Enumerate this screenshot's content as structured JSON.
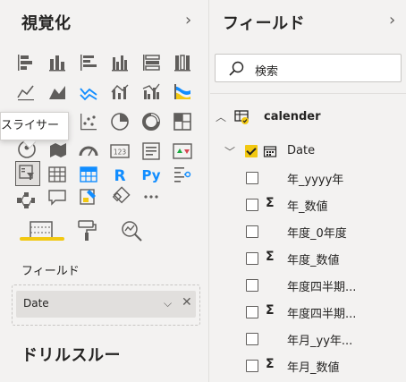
{
  "viz_pane": {
    "title": "視覚化",
    "tooltip": "スライサー",
    "section_label": "フィールド",
    "well_chip": "Date",
    "drill_title": "ドリルスルー"
  },
  "fields_pane": {
    "title": "フィールド",
    "search_placeholder": "検索",
    "table": "calender",
    "date_node": "Date",
    "fields": [
      {
        "label": "年_yyyy年",
        "sigma": false
      },
      {
        "label": "年_数値",
        "sigma": true
      },
      {
        "label": "年度_0年度",
        "sigma": false
      },
      {
        "label": "年度_数値",
        "sigma": true
      },
      {
        "label": "年度四半期...",
        "sigma": false
      },
      {
        "label": "年度四半期...",
        "sigma": true
      },
      {
        "label": "年月_yy年...",
        "sigma": false
      },
      {
        "label": "年月_数値",
        "sigma": true
      }
    ]
  },
  "visual_icons": [
    "stacked-bar-chart-icon",
    "stacked-column-chart-icon",
    "clustered-bar-chart-icon",
    "clustered-column-chart-icon",
    "100-stacked-bar-chart-icon",
    "100-stacked-column-chart-icon",
    "line-chart-icon",
    "area-chart-icon",
    "stacked-area-chart-icon",
    "line-and-column-chart-icon",
    "line-and-clustered-column-chart-icon",
    "ribbon-chart-icon",
    "waterfall-chart-icon",
    "funnel-chart-icon",
    "scatter-chart-icon",
    "pie-chart-icon",
    "donut-chart-icon",
    "treemap-icon",
    "map-icon",
    "filled-map-icon",
    "gauge-icon",
    "card-icon",
    "multi-row-card-icon",
    "kpi-icon",
    "slicer-icon",
    "table-icon",
    "matrix-icon",
    "r-visual-icon",
    "python-visual-icon",
    "key-influencers-icon",
    "decomposition-tree-icon",
    "qa-icon",
    "smart-narrative-icon",
    "paginated-report-icon",
    "more-visuals-icon"
  ],
  "accent_color": "#f2c811"
}
